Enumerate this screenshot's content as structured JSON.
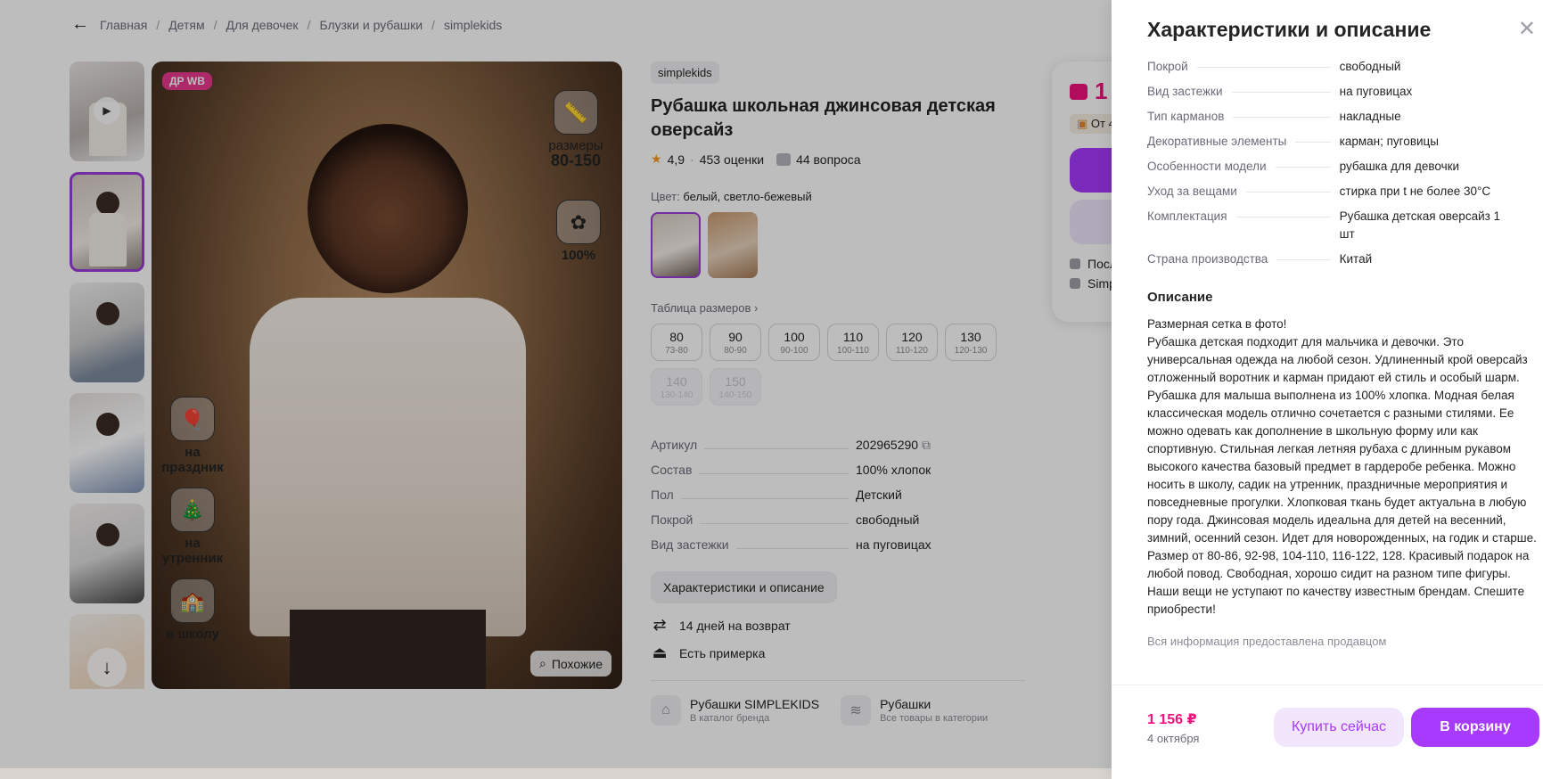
{
  "breadcrumbs": [
    "Главная",
    "Детям",
    "Для девочек",
    "Блузки и рубашки",
    "simplekids"
  ],
  "photo": {
    "badge": "ДР WB",
    "size_label": "размеры",
    "size_range": "80-150",
    "cotton": "100%",
    "holiday_1": "на",
    "holiday_2": "праздник",
    "morning_1": "на",
    "morning_2": "утренник",
    "school": "в школу",
    "similar": "Похожие"
  },
  "product": {
    "brand": "simplekids",
    "title": "Рубашка школьная джинсовая детская оверсайз",
    "rating": "4,9",
    "reviews": "453 оценки",
    "questions": "44 вопроса",
    "color_label": "Цвет:",
    "color_value": "белый, светло-бежевый",
    "size_table": "Таблица размеров",
    "sizes": [
      {
        "main": "80",
        "sub": "73-80",
        "available": true
      },
      {
        "main": "90",
        "sub": "80-90",
        "available": true
      },
      {
        "main": "100",
        "sub": "90-100",
        "available": true
      },
      {
        "main": "110",
        "sub": "100-110",
        "available": true
      },
      {
        "main": "120",
        "sub": "110-120",
        "available": true
      },
      {
        "main": "130",
        "sub": "120-130",
        "available": true
      },
      {
        "main": "140",
        "sub": "130-140",
        "available": false
      },
      {
        "main": "150",
        "sub": "140-150",
        "available": false
      }
    ],
    "specs": [
      {
        "k": "Артикул",
        "v": "202965290"
      },
      {
        "k": "Состав",
        "v": "100% хлопок"
      },
      {
        "k": "Пол",
        "v": "Детский"
      },
      {
        "k": "Покрой",
        "v": "свободный"
      },
      {
        "k": "Вид застежки",
        "v": "на пуговицах"
      }
    ],
    "chars_button": "Характеристики и описание",
    "perk_return": "14 дней на возврат",
    "perk_fitting": "Есть примерка",
    "cat_brand_title": "Рубашки SIMPLEKIDS",
    "cat_brand_sub": "В каталог бренда",
    "cat_all_title": "Рубашки",
    "cat_all_sub": "Все товары в категории"
  },
  "buy_card": {
    "price_fragment": "1",
    "note_fragment": "От 4",
    "line1": "Посл",
    "line2": "Simp"
  },
  "drawer": {
    "title": "Характеристики и описание",
    "specs": [
      {
        "k": "Покрой",
        "v": "свободный"
      },
      {
        "k": "Вид застежки",
        "v": "на пуговицах"
      },
      {
        "k": "Тип карманов",
        "v": "накладные"
      },
      {
        "k": "Декоративные элементы",
        "v": "карман; пуговицы"
      },
      {
        "k": "Особенности модели",
        "v": "рубашка для девочки"
      },
      {
        "k": "Уход за вещами",
        "v": "стирка при t не более 30°C"
      },
      {
        "k": "Комплектация",
        "v": "Рубашка детская оверсайз 1 шт"
      },
      {
        "k": "Страна производства",
        "v": "Китай"
      }
    ],
    "desc_title": "Описание",
    "desc_line1": "Размерная сетка в фото!",
    "desc_body": "Рубашка детская подходит для мальчика и девочки. Это универсальная одежда на любой сезон. Удлиненный крой оверсайз отложенный воротник и карман придают ей стиль и особый шарм. Рубашка для малыша выполнена из 100% хлопка. Модная белая классическая модель отлично сочетается с разными стилями. Ее можно одевать как дополнение в школьную форму или как спортивную. Стильная легкая летняя рубаха с длинным рукавом высокого качества базовый предмет в гардеробе ребенка. Можно носить в школу, садик на утренник, праздничные мероприятия и повседневные прогулки. Хлопковая ткань будет актуальна в любую пору года. Джинсовая модель идеальна для детей на весенний, зимний, осенний сезон. Идет для новорожденных, на годик и старше. Размер от 80-86, 92-98, 104-110, 116-122, 128. Красивый подарок на любой повод. Свободная, хорошо сидит на разном типе фигуры. Наши вещи не уступают по качеству известным брендам. Спешите приобрести!",
    "seller_note": "Вся информация предоставлена продавцом",
    "price": "1 156 ₽",
    "date": "4 октября",
    "buy_now": "Купить сейчас",
    "to_cart": "В корзину"
  },
  "colors": {
    "accent": "#a73afd",
    "price": "#f1117e",
    "star": "#ff9a17"
  }
}
